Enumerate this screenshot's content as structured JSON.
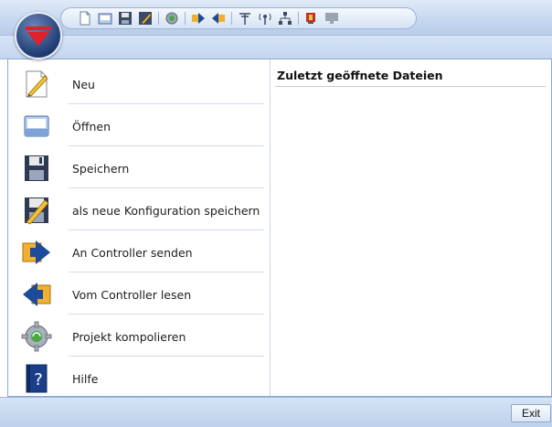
{
  "menu": {
    "items": [
      {
        "label": "Neu",
        "icon": "new-document-icon"
      },
      {
        "label": "Öffnen",
        "icon": "open-icon"
      },
      {
        "label": "Speichern",
        "icon": "save-icon"
      },
      {
        "label": "als neue Konfiguration speichern",
        "icon": "save-as-icon"
      },
      {
        "label": "An Controller senden",
        "icon": "send-to-controller-icon"
      },
      {
        "label": "Vom Controller lesen",
        "icon": "read-from-controller-icon"
      },
      {
        "label": "Projekt kompolieren",
        "icon": "compile-icon"
      },
      {
        "label": "Hilfe",
        "icon": "help-icon"
      }
    ]
  },
  "recent": {
    "title": "Zuletzt geöffnete Dateien"
  },
  "footer": {
    "exit_label": "Exit"
  },
  "colors": {
    "accent": "#1f3c73",
    "logo_red": "#e0202a",
    "frame_border": "#8ea7cf"
  }
}
